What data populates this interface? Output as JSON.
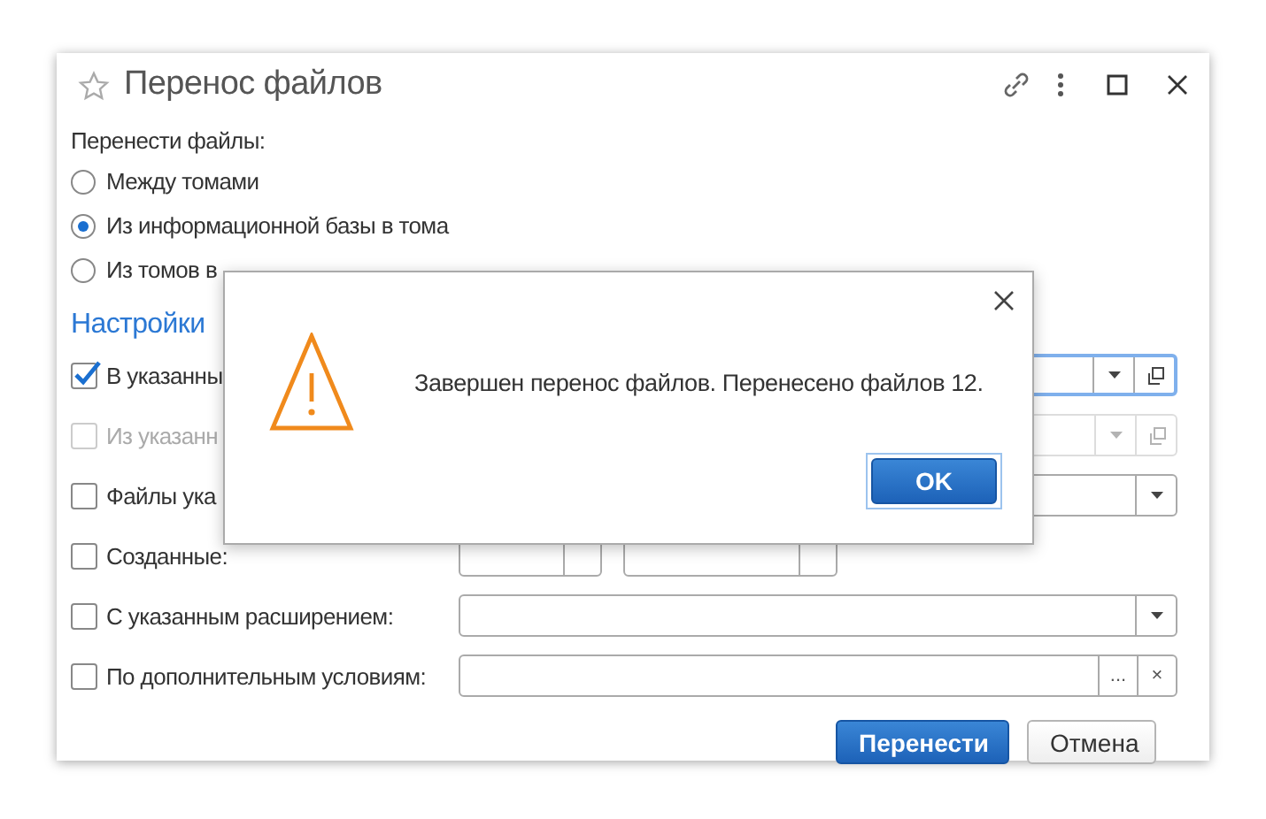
{
  "window": {
    "title": "Перенос файлов"
  },
  "transfer": {
    "label": "Перенести файлы:",
    "options": [
      {
        "label": "Между томами",
        "selected": false
      },
      {
        "label": "Из информационной базы в тома",
        "selected": true
      },
      {
        "label": "Из томов в",
        "selected": false
      }
    ]
  },
  "settings": {
    "title": "Настройки",
    "filters": [
      {
        "kind": "choice",
        "label": "В указанны",
        "checked": true,
        "disabled": false,
        "focused": true
      },
      {
        "kind": "choice",
        "label": "Из указанн",
        "checked": false,
        "disabled": true
      },
      {
        "kind": "select",
        "label": "Файлы ука",
        "checked": false,
        "disabled": false
      },
      {
        "kind": "period",
        "label": "Созданные:",
        "checked": false,
        "disabled": false
      },
      {
        "kind": "select",
        "label": "С указанным расширением:",
        "checked": false,
        "disabled": false
      },
      {
        "kind": "condition",
        "label": "По дополнительным условиям:",
        "checked": false,
        "disabled": false,
        "buttons": [
          "...",
          "×"
        ]
      }
    ]
  },
  "buttons": [
    {
      "kind": "primary",
      "label": "Перенести"
    },
    {
      "kind": "secondary",
      "label": "Отмена"
    }
  ],
  "dialog": {
    "message": "Завершен перенос файлов. Перенесено файлов 12.",
    "buttons": [
      {
        "kind": "primary",
        "label": "OK"
      }
    ]
  }
}
